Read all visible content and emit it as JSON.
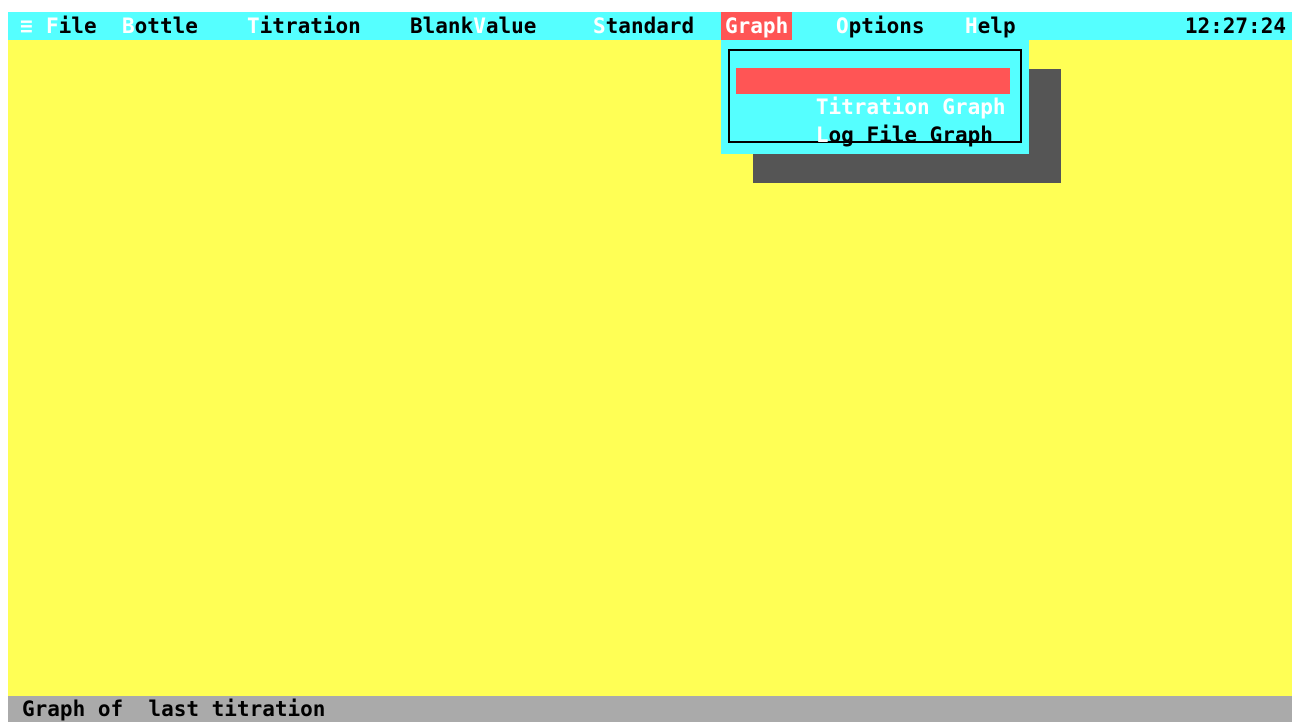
{
  "menubar": {
    "system_icon": "≡",
    "items": [
      {
        "hotkey": "F",
        "rest": "ile"
      },
      {
        "hotkey": "B",
        "rest": "ottle"
      },
      {
        "hotkey": "T",
        "rest": "itration"
      },
      {
        "rest_prefix": "Blank",
        "hotkey": "V",
        "rest": "alue"
      },
      {
        "hotkey": "S",
        "rest": "tandard"
      },
      {
        "label": "Graph"
      },
      {
        "hotkey": "O",
        "rest": "ptions"
      },
      {
        "hotkey": "H",
        "rest": "elp"
      }
    ],
    "clock": "12:27:24"
  },
  "graph_menu": {
    "items": [
      {
        "label": "Titration Graph"
      },
      {
        "hotkey": "L",
        "rest": "og File Graph"
      }
    ]
  },
  "status": {
    "text": "Graph of  last titration"
  },
  "colors": {
    "background": "#ffff55",
    "menubar": "#55ffff",
    "highlight": "#ff5555",
    "status": "#aaaaaa",
    "shadow": "#555555"
  }
}
